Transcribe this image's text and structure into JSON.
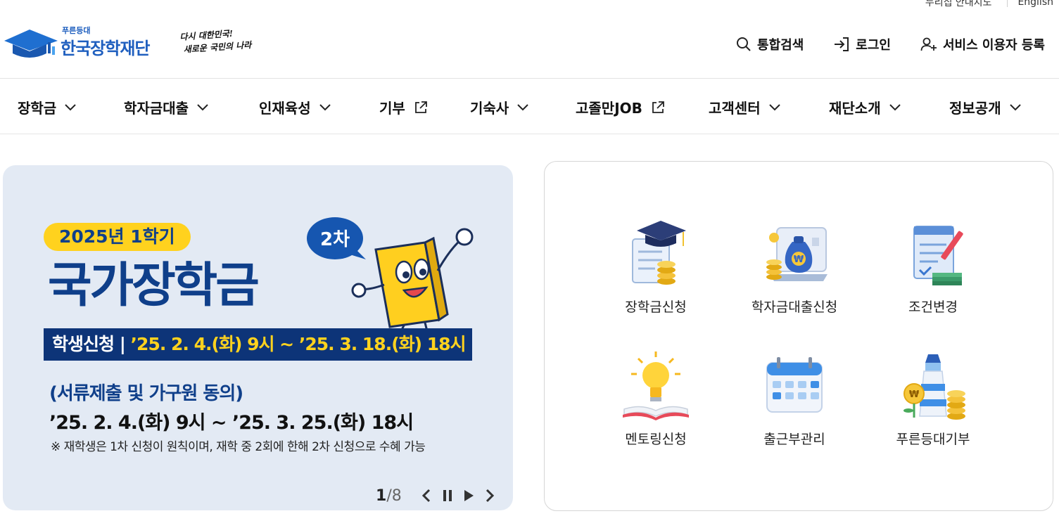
{
  "utility": {
    "sitemap": "누리집 안내지도",
    "english": "English"
  },
  "header": {
    "logo_sub": "푸른등대",
    "logo_name": "한국장학재단",
    "slogan_line1": "다시 대한민국!",
    "slogan_line2": "새로운 국민의 나라",
    "search": "통합검색",
    "login": "로그인",
    "register": "서비스 이용자 등록"
  },
  "gnb": [
    {
      "label": "장학금",
      "type": "dropdown"
    },
    {
      "label": "학자금대출",
      "type": "dropdown"
    },
    {
      "label": "인재육성",
      "type": "dropdown"
    },
    {
      "label": "기부",
      "type": "external"
    },
    {
      "label": "기숙사",
      "type": "dropdown"
    },
    {
      "label": "고졸만JOB",
      "type": "external"
    },
    {
      "label": "고객센터",
      "type": "dropdown"
    },
    {
      "label": "재단소개",
      "type": "dropdown"
    },
    {
      "label": "정보공개",
      "type": "dropdown"
    }
  ],
  "banner": {
    "pill": "2025년 1학기",
    "title": "국가장학금",
    "round_badge": "2차",
    "period_label": "학생신청 | ",
    "period_value": "’25. 2. 4.(화) 9시 ~ ’25. 3. 18.(화) 18시",
    "docs_title": "(서류제출 및 가구원 동의)",
    "docs_date": "’25. 2. 4.(화) 9시 ~ ’25. 3. 25.(화) 18시",
    "note": "※ 재학생은 1차 신청이 원칙이며, 재학 중 2회에 한해 2차 신청으로 수혜 가능",
    "current": "1",
    "total": "/8",
    "colors": {
      "navy": "#0f3f8a",
      "yellow": "#ffd21e",
      "bg": "#e3eaf4"
    }
  },
  "quick": [
    {
      "label": "장학금신청",
      "icon": "graduation-cap-icon"
    },
    {
      "label": "학자금대출신청",
      "icon": "money-bag-icon"
    },
    {
      "label": "조건변경",
      "icon": "document-pen-icon"
    },
    {
      "label": "멘토링신청",
      "icon": "lightbulb-book-icon"
    },
    {
      "label": "출근부관리",
      "icon": "calendar-icon"
    },
    {
      "label": "푸른등대기부",
      "icon": "lighthouse-coins-icon"
    }
  ]
}
